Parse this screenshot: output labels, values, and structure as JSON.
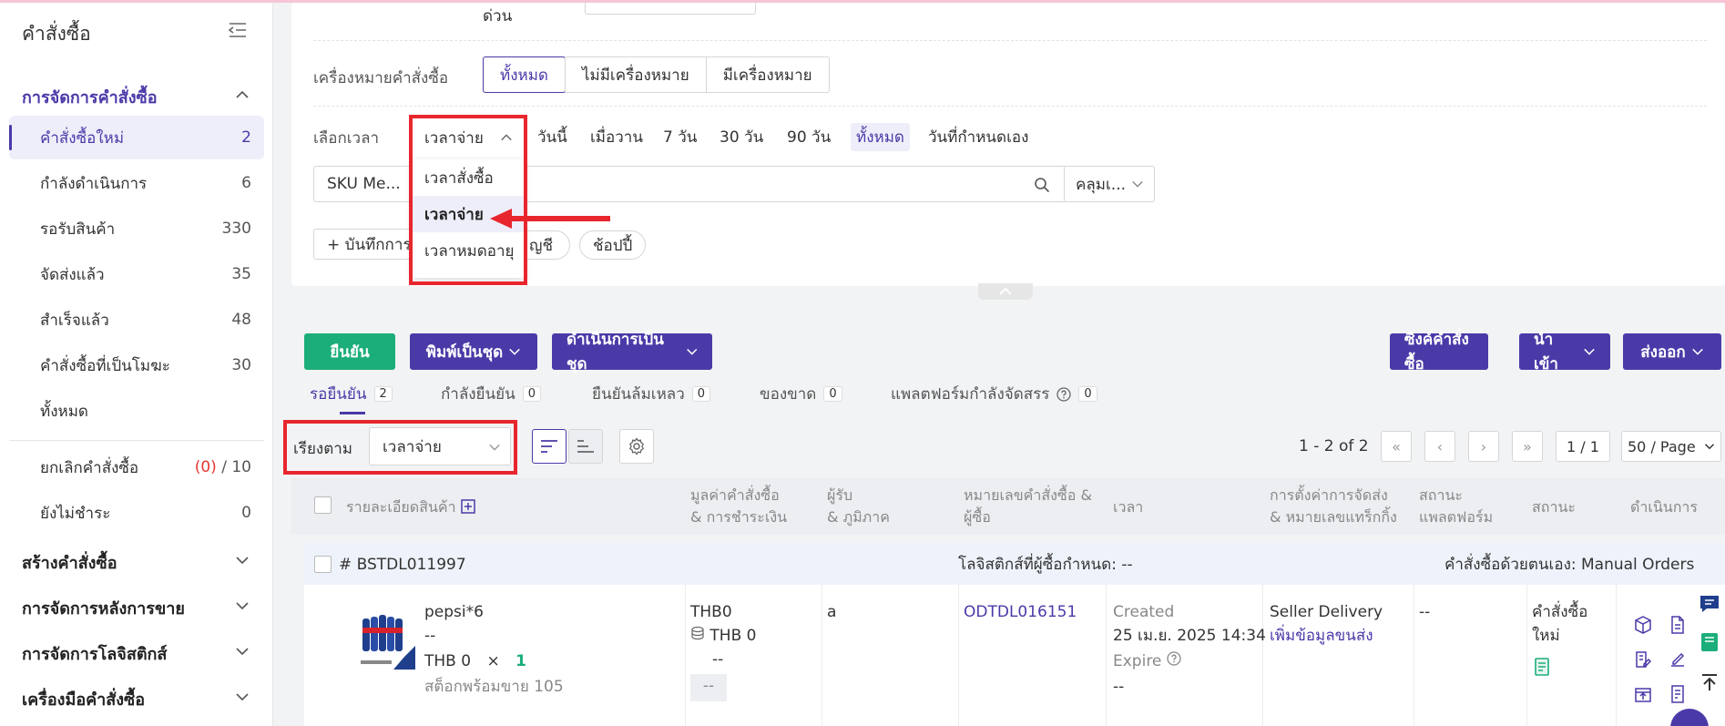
{
  "sidebar": {
    "title": "คำสั่งซื้อ",
    "order_mgmt": "การจัดการคำสั่งซื้อ",
    "items": [
      {
        "label": "คำสั่งซื้อใหม่",
        "count": "2"
      },
      {
        "label": "กำลังดำเนินการ",
        "count": "6"
      },
      {
        "label": "รอรับสินค้า",
        "count": "330"
      },
      {
        "label": "จัดส่งแล้ว",
        "count": "35"
      },
      {
        "label": "สำเร็จแล้ว",
        "count": "48"
      },
      {
        "label": "คำสั่งซื้อที่เป็นโมฆะ",
        "count": "30"
      },
      {
        "label": "ทั้งหมด",
        "count": ""
      }
    ],
    "cancel": {
      "label": "ยกเลิกคำสั่งซื้อ",
      "red": "(0)",
      "rest": " / 10"
    },
    "unpaid": {
      "label": "ยังไม่ชำระ",
      "count": "0"
    },
    "sections": [
      "สร้างคำสั่งซื้อ",
      "การจัดการหลังการขาย",
      "การจัดการโลจิสติกส์",
      "เครื่องมือคำสั่งซื้อ"
    ]
  },
  "filters": {
    "urgent_label": "ด่วน",
    "mark_label": "เครื่องหมายคำสั่งซื้อ",
    "mark_options": [
      "ทั้งหมด",
      "ไม่มีเครื่องหมาย",
      "มีเครื่องหมาย"
    ],
    "time_label": "เลือกเวลา",
    "time_select": "เวลาจ่าย",
    "time_options": [
      "วันนี้",
      "เมื่อวาน",
      "7 วัน",
      "30 วัน",
      "90 วัน",
      "ทั้งหมด",
      "วันที่กำหนดเอง"
    ],
    "time_menu": [
      "เวลาสั่งซื้อ",
      "เวลาจ่าย",
      "เวลาหมดอายุ"
    ],
    "sku_select": "SKU Me...",
    "fuzzy_select": "คลุมเ...",
    "save_filter": "+ บันทึกการ",
    "pill_account": "ญชี",
    "pill_shopee": "ช้อปปี้"
  },
  "actions": {
    "confirm": "ยืนยัน",
    "print_batch": "พิมพ์เป็นชุด",
    "process_batch": "ดำเนินการเป็นชุด",
    "sync": "ซิงค์คำสั่งซื้อ",
    "import": "นำเข้า",
    "export": "ส่งออก"
  },
  "subtabs": [
    {
      "label": "รอยืนยัน",
      "count": "2"
    },
    {
      "label": "กำลังยืนยัน",
      "count": "0"
    },
    {
      "label": "ยืนยันล้มเหลว",
      "count": "0"
    },
    {
      "label": "ของขาด",
      "count": "0"
    },
    {
      "label": "แพลตฟอร์มกำลังจัดสรร",
      "count": "0"
    }
  ],
  "sort": {
    "label": "เรียงตาม",
    "value": "เวลาจ่าย"
  },
  "pagination": {
    "range": "1 - 2 of 2",
    "page": "1 / 1",
    "per_page": "50 / Page"
  },
  "table": {
    "headers": {
      "product": "รายละเอียดสินค้า",
      "value1": "มูลค่าคำสั่งซื้อ",
      "value2": "& การชำระเงิน",
      "recv1": "ผู้รับ",
      "recv2": "& ภูมิภาค",
      "ono1": "หมายเลขคำสั่งซื้อ &",
      "ono2": "ผู้ซื้อ",
      "time": "เวลา",
      "ship1": "การตั้งค่าการจัดส่ง",
      "ship2": "& หมายเลขแทร็กกิ้ง",
      "plat1": "สถานะ",
      "plat2": "แพลตฟอร์ม",
      "status": "สถานะ",
      "action": "ดำเนินการ"
    },
    "order": {
      "id": "# BSTDL011997",
      "logistics": "โลจิสติกส์ที่ผู้ซื้อกำหนด: --",
      "type": "คำสั่งซื้อด้วยตนเอง: Manual Orders",
      "product_name": "pepsi*6",
      "product_sub": "--",
      "price": "THB 0",
      "times": "×",
      "qty": "1",
      "stock": "สต็อกพร้อมขาย 105",
      "value": "THB0",
      "paid": "THB 0",
      "paid_sub": "--",
      "paid_box": "--",
      "recipient": "a",
      "order_no": "ODTDL016151",
      "created_label": "Created",
      "created_time": "25 เม.ย. 2025 14:34",
      "expire_label": "Expire",
      "expire_value": "--",
      "ship": "Seller Delivery",
      "ship_link": "เพิ่มข้อมูลขนส่ง",
      "platform_status": "--",
      "status": "คำสั่งซื้อใหม่"
    }
  },
  "colors": {
    "accent": "#4a3aa8",
    "green": "#1cae7a",
    "red": "#e8262d"
  }
}
